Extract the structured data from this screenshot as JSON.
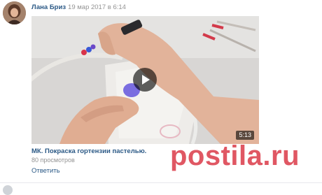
{
  "post": {
    "author": "Лана Бриз",
    "date": "19 мар 2017 в 6:14",
    "video": {
      "duration": "5:13",
      "title": "МК. Покраска гортензии пастелью.",
      "views": "80 просмотров"
    },
    "reply_label": "Ответить"
  },
  "icons": {
    "play": "play-icon",
    "avatar": "user-avatar"
  },
  "watermark": "postila.ru",
  "colors": {
    "link": "#2a5885",
    "meta": "#939393",
    "watermark": "#d72837"
  }
}
